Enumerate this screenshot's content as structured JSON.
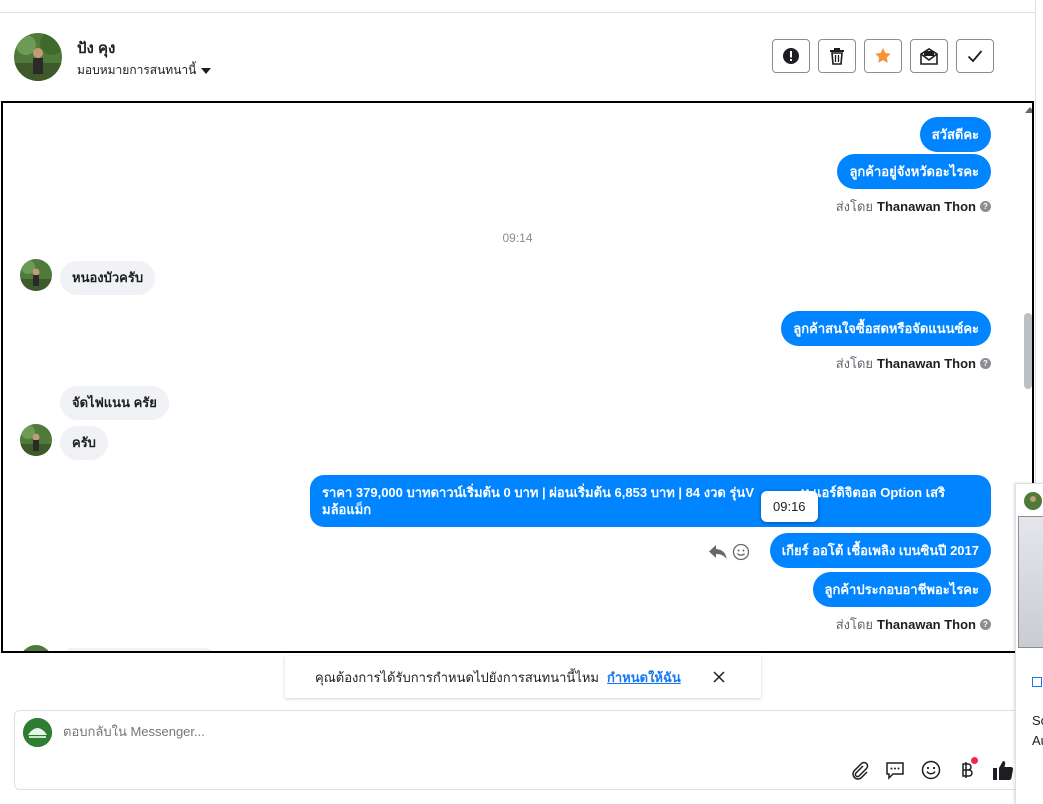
{
  "header": {
    "name": "ปัง คุง",
    "assign_label": "มอบหมายการสนทนานี้",
    "actions": [
      {
        "name": "report-spam-button",
        "icon": "exclamation-circle-icon"
      },
      {
        "name": "delete-button",
        "icon": "trash-icon"
      },
      {
        "name": "star-button",
        "icon": "star-icon",
        "color": "#f7923a"
      },
      {
        "name": "mark-unread-button",
        "icon": "envelope-open-icon"
      },
      {
        "name": "mark-done-button",
        "icon": "check-icon"
      }
    ]
  },
  "messages": {
    "m1": "สวัสดีคะ",
    "m2": "ลูกค้าอยู่จังหวัดอะไรคะ",
    "sent_by_1": {
      "prefix": "ส่งโดย",
      "agent": "Thanawan Thon"
    },
    "time_1": "09:14",
    "in1": "หนองบัวครับ",
    "m3": "ลูกค้าสนใจซื้อสดหรือจัดแนนซ์คะ",
    "sent_by_2": {
      "prefix": "ส่งโดย",
      "agent": "Thanawan Thon"
    },
    "in2": "จัดไฟแนน ครัย",
    "in3": "ครับ",
    "m4_line1": "ราคา 379,000 บาทดาวน์เริ่มต้น 0 บาท | ผ่อนเริ่มต้น 6,853 บาท | 84 งวด รุ่นV",
    "m4_line1_end": "ท แอร์ดิจิตอล Option เสริ",
    "m4_line2": "มล้อแม็ก",
    "tooltip_time": "09:16",
    "m5": "เกียร์ ออโต้ เชื้อเพลิง เบนซินปี 2017",
    "m6": "ลูกค้าประกอบอาชีพอะไรคะ",
    "sent_by_3": {
      "prefix": "ส่งโดย",
      "agent": "Thanawan Thon"
    }
  },
  "notice": {
    "text": "คุณต้องการได้รับการกำหนดไปยังการสนทนานี้ไหม",
    "link": "กำหนดให้ฉัน"
  },
  "composer": {
    "placeholder": "ตอบกลับใน Messenger...",
    "tools": [
      "paperclip-icon",
      "chat-bubble-icon",
      "emoji-icon",
      "baht-icon",
      "thumbs-up-icon"
    ]
  },
  "side_panel": {
    "text_1": "So",
    "text_2": "Au"
  },
  "colors": {
    "outgoing_bubble": "#0084ff",
    "incoming_bubble": "#f0f2f5",
    "star": "#f7923a",
    "link": "#1877f2"
  }
}
